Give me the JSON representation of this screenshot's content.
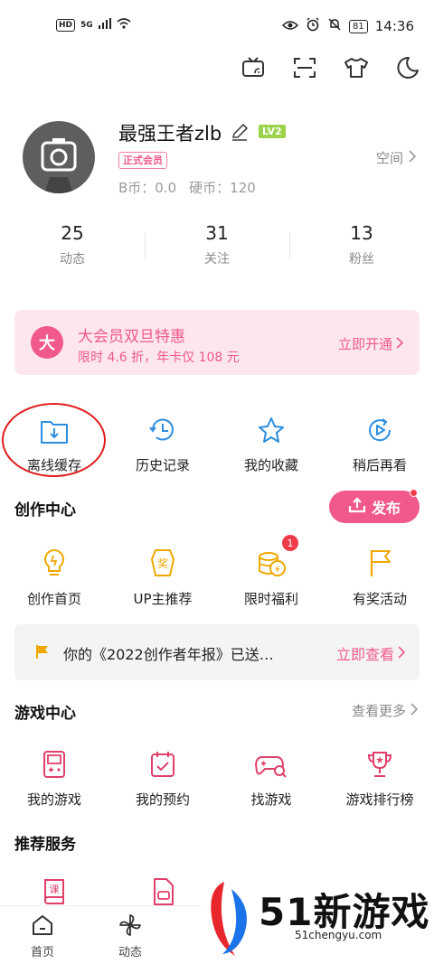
{
  "status_bar": {
    "hd": "HD",
    "network": "5G",
    "battery": "81",
    "time": "14:36"
  },
  "top_icons": [
    "tv-cast-icon",
    "scan-icon",
    "shirt-icon",
    "moon-icon"
  ],
  "profile": {
    "username": "最强王者zlb",
    "level": "LV2",
    "vip_badge": "正式会员",
    "b_coins": "B币：0.0",
    "hard_coins": "硬币：120",
    "space_link": "空间"
  },
  "stats": [
    {
      "value": "25",
      "label": "动态"
    },
    {
      "value": "31",
      "label": "关注"
    },
    {
      "value": "13",
      "label": "粉丝"
    }
  ],
  "vip_banner": {
    "icon_text": "大",
    "title": "大会员双旦特惠",
    "subtitle": "限时 4.6 折，年卡仅 108 元",
    "action": "立即开通"
  },
  "quick_actions": [
    {
      "label": "离线缓存",
      "icon": "download-folder-icon"
    },
    {
      "label": "历史记录",
      "icon": "history-clock-icon"
    },
    {
      "label": "我的收藏",
      "icon": "star-icon"
    },
    {
      "label": "稍后再看",
      "icon": "watch-later-icon"
    }
  ],
  "creation_center": {
    "title": "创作中心",
    "publish_button": "发布",
    "items": [
      {
        "label": "创作首页",
        "icon": "bulb-icon"
      },
      {
        "label": "UP主推荐",
        "icon": "award-icon"
      },
      {
        "label": "限时福利",
        "icon": "coins-icon",
        "badge": "1"
      },
      {
        "label": "有奖活动",
        "icon": "flag-icon"
      }
    ]
  },
  "notice": {
    "text": "你的《2022创作者年报》已送…",
    "action": "立即查看"
  },
  "game_center": {
    "title": "游戏中心",
    "more": "查看更多",
    "items": [
      {
        "label": "我的游戏",
        "icon": "gameboy-icon"
      },
      {
        "label": "我的预约",
        "icon": "calendar-check-icon"
      },
      {
        "label": "找游戏",
        "icon": "gamepad-search-icon"
      },
      {
        "label": "游戏排行榜",
        "icon": "trophy-icon"
      }
    ]
  },
  "recommended": {
    "title": "推荐服务",
    "items": [
      {
        "label": "课",
        "icon": "course-book-icon"
      },
      {
        "label": "",
        "icon": "card-icon"
      }
    ]
  },
  "bottom_nav": [
    {
      "label": "首页",
      "icon": "home-icon"
    },
    {
      "label": "动态",
      "icon": "pinwheel-icon"
    }
  ],
  "watermark": {
    "title": "51新游戏",
    "url": "51chengyu.com"
  },
  "colors": {
    "accent": "#f0598a",
    "vip_bg": "#fde7ec",
    "icon_blue": "#2d8ee0",
    "icon_yellow": "#f0a800",
    "icon_pink": "#e0406a",
    "annotation_red": "#e01e1e"
  }
}
